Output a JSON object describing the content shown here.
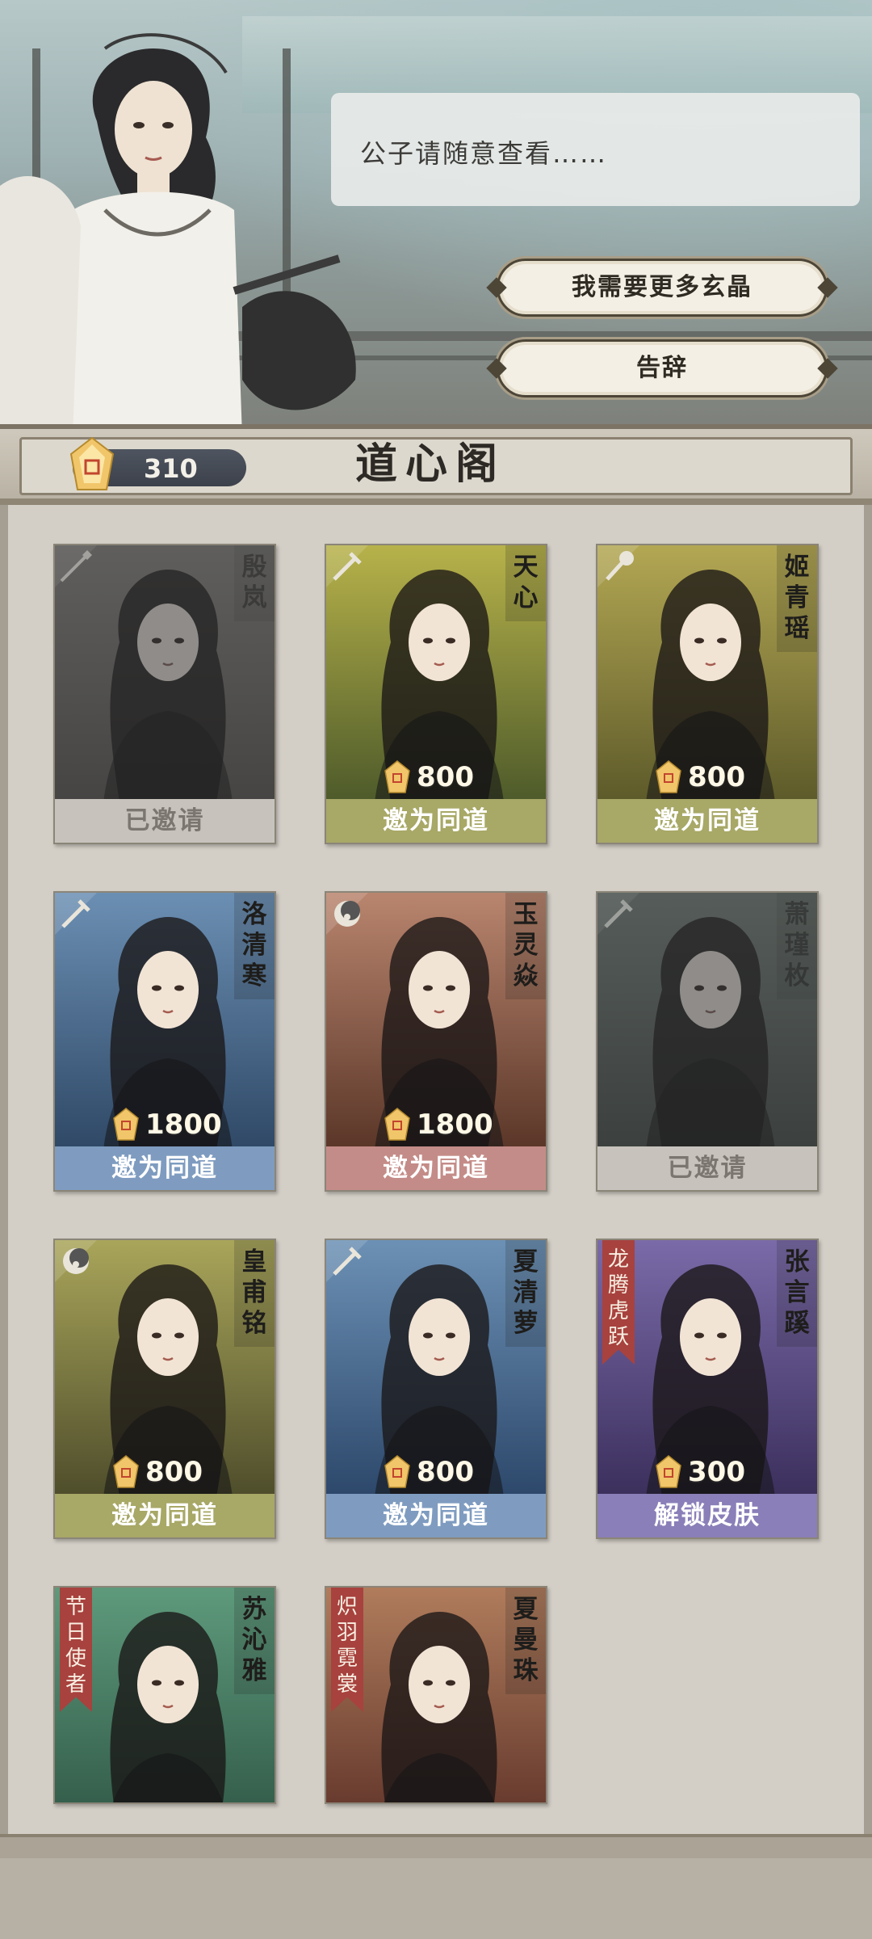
{
  "dialog": {
    "text": "公子请随意查看……",
    "options": [
      "我需要更多玄晶",
      "告辞"
    ]
  },
  "header": {
    "currency_value": "310",
    "title": "道心阁"
  },
  "cards": [
    {
      "name": "殷岚",
      "price": "",
      "action": "已邀请",
      "state": "invited",
      "tag": "",
      "class_icon": "spear-icon",
      "bg": [
        "#8f8a80",
        "#5b5750"
      ],
      "action_color": "#c7c3bc"
    },
    {
      "name": "天心",
      "price": "800",
      "action": "邀为同道",
      "state": "available",
      "tag": "",
      "class_icon": "sword-icon",
      "bg": [
        "#b7b24a",
        "#4d5a2a"
      ],
      "action_color": "#a8a867"
    },
    {
      "name": "姬青瑶",
      "price": "800",
      "action": "邀为同道",
      "state": "available",
      "tag": "",
      "class_icon": "hammer-icon",
      "bg": [
        "#b3a753",
        "#5d5a2a"
      ],
      "action_color": "#a8a867"
    },
    {
      "name": "洛清寒",
      "price": "1800",
      "action": "邀为同道",
      "state": "available",
      "tag": "",
      "class_icon": "sword-icon",
      "bg": [
        "#6b8fb3",
        "#2f4866"
      ],
      "action_color": "#7f9cc0"
    },
    {
      "name": "玉灵焱",
      "price": "1800",
      "action": "邀为同道",
      "state": "available",
      "tag": "",
      "class_icon": "moon-icon",
      "bg": [
        "#b9856e",
        "#5a3628"
      ],
      "action_color": "#c48c88"
    },
    {
      "name": "萧瑾枚",
      "price": "",
      "action": "已邀请",
      "state": "invited",
      "tag": "",
      "class_icon": "sword-icon",
      "bg": [
        "#6a8b7c",
        "#3b5148"
      ],
      "action_color": "#c7c3bc"
    },
    {
      "name": "皇甫铭",
      "price": "800",
      "action": "邀为同道",
      "state": "available",
      "tag": "",
      "class_icon": "moon-icon",
      "bg": [
        "#a9a55a",
        "#4e4d2b"
      ],
      "action_color": "#a8a867"
    },
    {
      "name": "夏清萝",
      "price": "800",
      "action": "邀为同道",
      "state": "available",
      "tag": "",
      "class_icon": "sword-icon",
      "bg": [
        "#6c91b5",
        "#2c476a"
      ],
      "action_color": "#7f9cc0"
    },
    {
      "name": "张言蹊",
      "price": "300",
      "action": "解锁皮肤",
      "state": "skin",
      "tag": "龙腾虎跃",
      "class_icon": "",
      "bg": [
        "#7a6aa8",
        "#3b2f5c"
      ],
      "action_color": "#8a7fb8"
    },
    {
      "name": "苏沁雅",
      "price": "",
      "action": "",
      "state": "partial",
      "tag": "节日使者",
      "class_icon": "",
      "bg": [
        "#5e9a7c",
        "#2d5443"
      ],
      "action_color": "#6f9a86"
    },
    {
      "name": "夏曼珠",
      "price": "",
      "action": "",
      "state": "partial",
      "tag": "炽羽霓裳",
      "class_icon": "",
      "bg": [
        "#b07c5c",
        "#5a2f26"
      ],
      "action_color": "#c48c88"
    }
  ]
}
